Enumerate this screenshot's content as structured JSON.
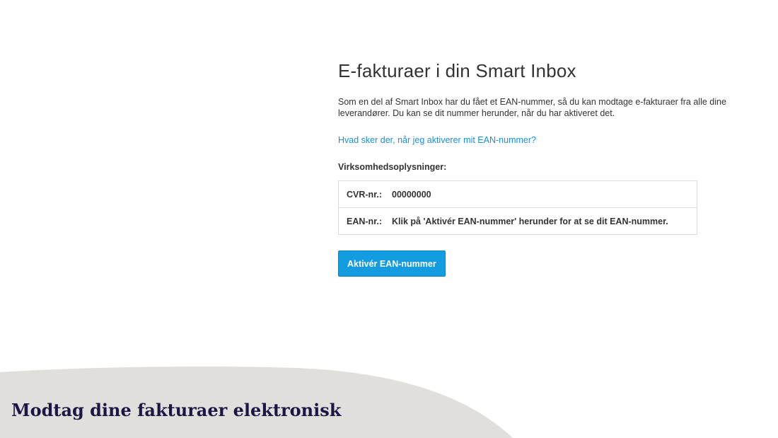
{
  "main": {
    "title": "E-fakturaer i din Smart Inbox",
    "intro": "Som en del af Smart Inbox har du fået et EAN-nummer, så du kan modtage e-fakturaer fra alle dine leverandører. Du kan se dit nummer herunder, når du har aktiveret det.",
    "help_link": "Hvad sker der, når jeg aktiverer mit EAN-nummer?",
    "section_label": "Virksomhedsoplysninger:",
    "rows": [
      {
        "key": "CVR-nr.:",
        "value": "00000000"
      },
      {
        "key": "EAN-nr.:",
        "value": "Klik på 'Aktivér EAN-nummer' herunder for at se dit EAN-nummer."
      }
    ],
    "activate_button": "Aktivér EAN-nummer"
  },
  "footer": {
    "caption": "Modtag dine fakturaer elektronisk",
    "background_color": "#e1dfdc"
  },
  "colors": {
    "link": "#1a8fd6",
    "button": "#139ce0",
    "caption_text": "#1c1645"
  }
}
